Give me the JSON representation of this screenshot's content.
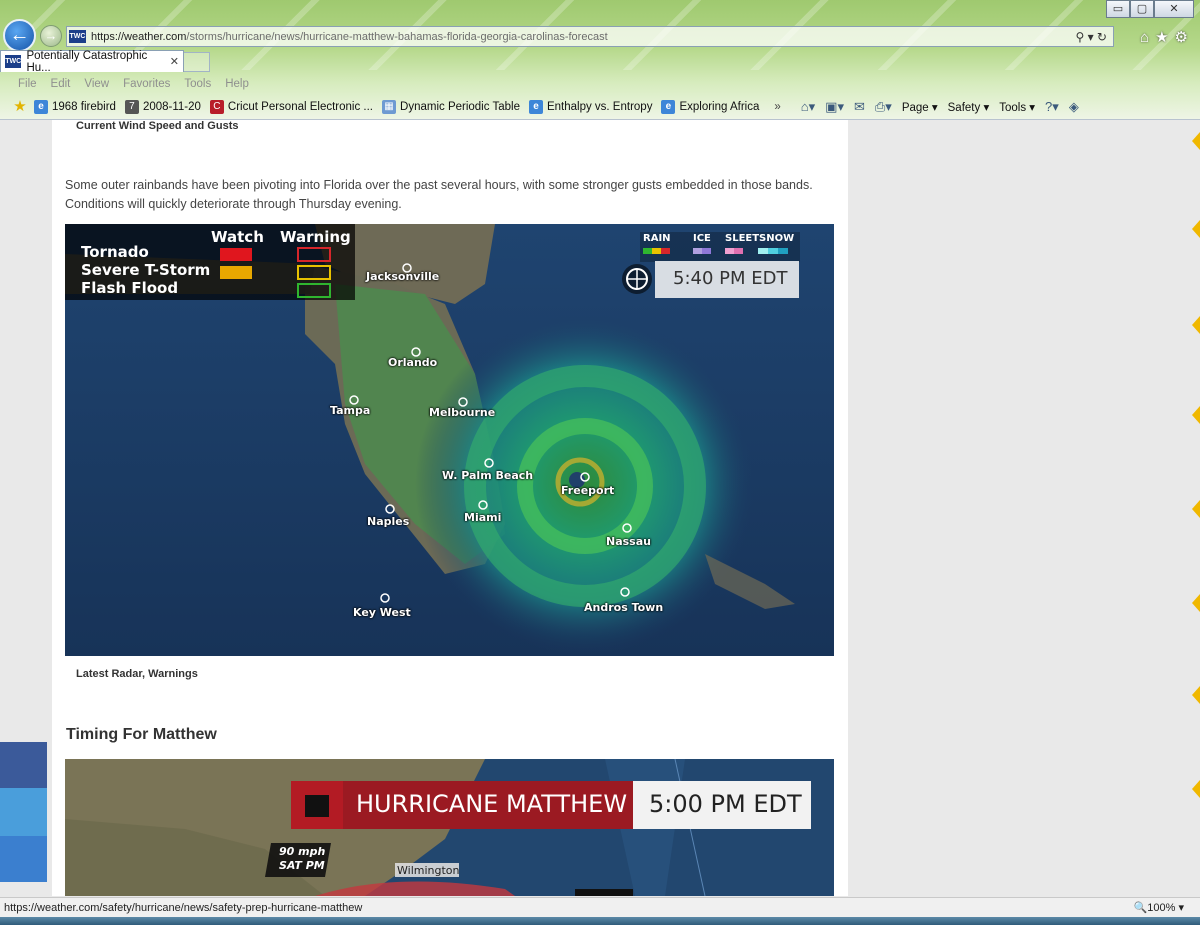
{
  "browser": {
    "url_host": "https://weather.com",
    "url_path": "/storms/hurricane/news/hurricane-matthew-bahamas-florida-georgia-carolinas-forecast",
    "tab_title": "Potentially Catastrophic Hu...",
    "tab_close": "✕",
    "addr_controls": "⚲ ▾ ↻",
    "right_icons": "⌂★⚙",
    "window_buttons": [
      "▭",
      "▢",
      "✕"
    ],
    "menu": [
      "File",
      "Edit",
      "View",
      "Favorites",
      "Tools",
      "Help"
    ],
    "favorites": [
      "1968 firebird",
      "2008-11-20",
      "Cricut Personal Electronic ...",
      "Dynamic Periodic Table",
      "Enthalpy vs. Entropy",
      "Exploring Africa"
    ],
    "favorites_overflow": "»",
    "commands": [
      "Page ▾",
      "Safety ▾",
      "Tools ▾"
    ],
    "status_url": "https://weather.com/safety/hurricane/news/safety-prep-hurricane-matthew",
    "zoom": "100%"
  },
  "article": {
    "caption_top": "Current Wind Speed and Gusts",
    "paragraph": "Some outer rainbands have been pivoting into Florida over the past several hours, with some stronger gusts embedded in those bands. Conditions will quickly deteriorate through Thursday evening.",
    "radar_caption": "Latest Radar, Warnings",
    "section_heading": "Timing For Matthew"
  },
  "radar": {
    "legend_header_watch": "Watch",
    "legend_header_warning": "Warning",
    "legend_rows": [
      "Tornado",
      "Severe T-Storm",
      "Flash Flood"
    ],
    "precip_types": [
      "RAIN",
      "ICE",
      "SLEET",
      "SNOW"
    ],
    "time": "5:40 PM EDT",
    "cities": [
      "Jacksonville",
      "Orlando",
      "Tampa",
      "Melbourne",
      "W. Palm Beach",
      "Freeport",
      "Naples",
      "Miami",
      "Nassau",
      "Key West",
      "Andros Town"
    ],
    "colors": {
      "watch_tornado": "#e0161e",
      "watch_tstorm": "#e8a800",
      "warn_tornado": "#d6262b",
      "warn_tstorm": "#e8c200",
      "warn_flood": "#2fb52f"
    }
  },
  "timing": {
    "banner_title": "HURRICANE MATTHEW",
    "banner_time": "5:00 PM EDT",
    "wind_label_1": "90 mph",
    "wind_label_2": "SAT PM",
    "city": "Wilmington"
  }
}
